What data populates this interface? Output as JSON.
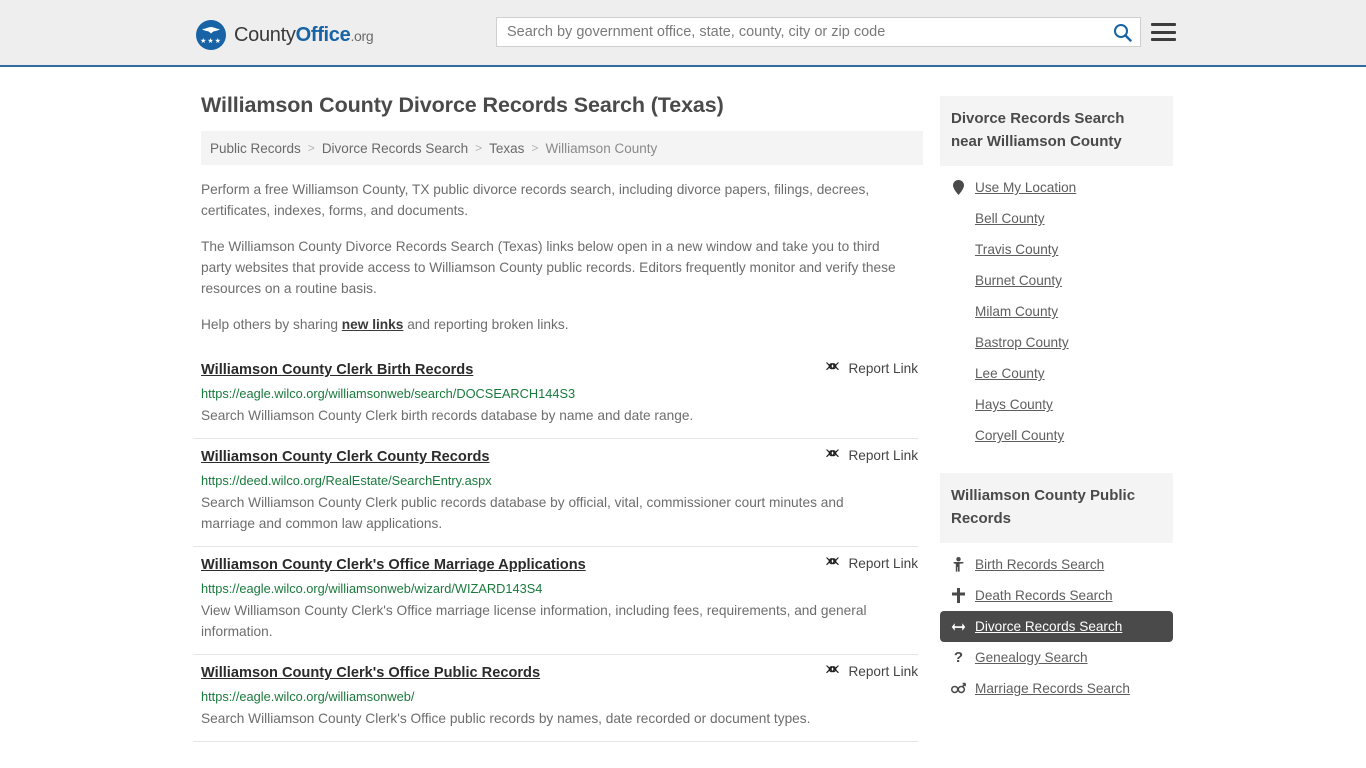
{
  "header": {
    "logo": {
      "text_1": "County",
      "text_2": "Office",
      "text_3": ".org",
      "stars": "★★★"
    },
    "search": {
      "placeholder": "Search by government office, state, county, city or zip code",
      "value": "",
      "button_icon": "search-icon"
    },
    "menu_icon": "hamburger-menu-icon"
  },
  "main": {
    "title": "Williamson County Divorce Records Search (Texas)",
    "breadcrumb": [
      {
        "label": "Public Records",
        "current": false
      },
      {
        "label": "Divorce Records Search",
        "current": false
      },
      {
        "label": "Texas",
        "current": false
      },
      {
        "label": "Williamson County",
        "current": true
      }
    ],
    "breadcrumb_separator": ">",
    "intro": {
      "p1": "Perform a free Williamson County, TX public divorce records search, including divorce papers, filings, decrees, certificates, indexes, forms, and documents.",
      "p2": "The Williamson County Divorce Records Search (Texas) links below open in a new window and take you to third party websites that provide access to Williamson County public records. Editors frequently monitor and verify these resources on a routine basis.",
      "p3_before": "Help others by sharing ",
      "p3_link": "new links",
      "p3_after": " and reporting broken links."
    },
    "report_link_label": "Report Link",
    "results": [
      {
        "title": "Williamson County Clerk Birth Records",
        "url": "https://eagle.wilco.org/williamsonweb/search/DOCSEARCH144S3",
        "description": "Search Williamson County Clerk birth records database by name and date range."
      },
      {
        "title": "Williamson County Clerk County Records",
        "url": "https://deed.wilco.org/RealEstate/SearchEntry.aspx",
        "description": "Search Williamson County Clerk public records database by official, vital, commissioner court minutes and marriage and common law applications."
      },
      {
        "title": "Williamson County Clerk's Office Marriage Applications",
        "url": "https://eagle.wilco.org/williamsonweb/wizard/WIZARD143S4",
        "description": "View Williamson County Clerk's Office marriage license information, including fees, requirements, and general information."
      },
      {
        "title": "Williamson County Clerk's Office Public Records",
        "url": "https://eagle.wilco.org/williamsonweb/",
        "description": "Search Williamson County Clerk's Office public records by names, date recorded or document types."
      }
    ]
  },
  "sidebar": {
    "panels": [
      {
        "heading": "Divorce Records Search near Williamson County",
        "items": [
          {
            "label": "Use My Location",
            "icon": "map-pin-icon",
            "active": false
          },
          {
            "label": "Bell County",
            "icon": "",
            "active": false
          },
          {
            "label": "Travis County",
            "icon": "",
            "active": false
          },
          {
            "label": "Burnet County",
            "icon": "",
            "active": false
          },
          {
            "label": "Milam County",
            "icon": "",
            "active": false
          },
          {
            "label": "Bastrop County",
            "icon": "",
            "active": false
          },
          {
            "label": "Lee County",
            "icon": "",
            "active": false
          },
          {
            "label": "Hays County",
            "icon": "",
            "active": false
          },
          {
            "label": "Coryell County",
            "icon": "",
            "active": false
          }
        ]
      },
      {
        "heading": "Williamson County Public Records",
        "items": [
          {
            "label": "Birth Records Search",
            "icon": "baby-icon",
            "active": false
          },
          {
            "label": "Death Records Search",
            "icon": "cross-icon",
            "active": false
          },
          {
            "label": "Divorce Records Search",
            "icon": "split-arrows-icon",
            "active": true
          },
          {
            "label": "Genealogy Search",
            "icon": "question-mark-icon",
            "active": false
          },
          {
            "label": "Marriage Records Search",
            "icon": "male-female-icon",
            "active": false
          }
        ]
      }
    ]
  },
  "colors": {
    "brand_blue": "#1763a6",
    "header_bg": "#eeeeee",
    "header_border": "#2f6ca3",
    "url_green": "#1a7a3c",
    "active_bg": "#4a4a4a",
    "panel_head_bg": "#f4f4f4"
  }
}
